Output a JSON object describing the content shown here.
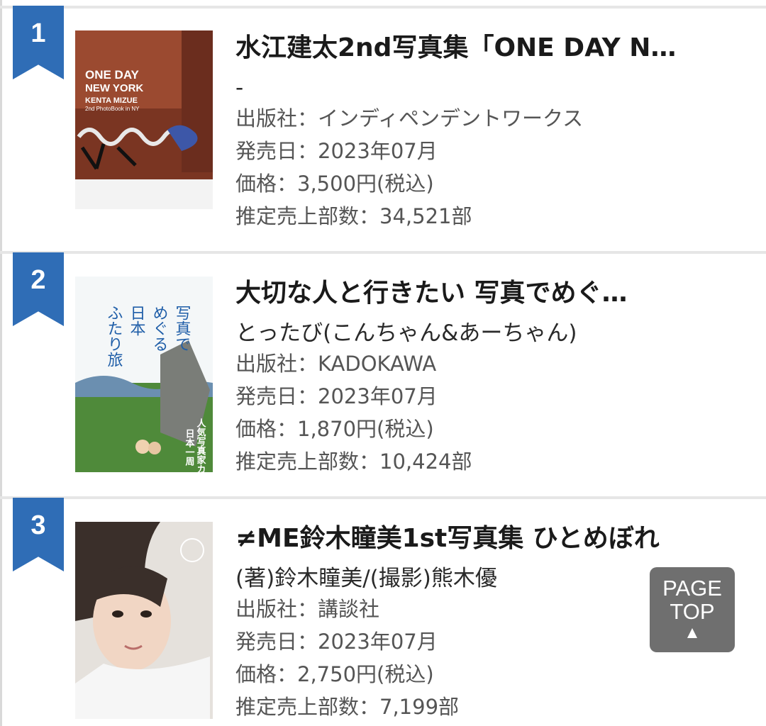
{
  "labels": {
    "publisher": "出版社：",
    "release": "発売日：",
    "price": "価格：",
    "estimate": "推定売上部数："
  },
  "items": [
    {
      "rank": "1",
      "title": "水江建太2nd写真集「ONE DAY N…",
      "author": "-",
      "publisher": "インディペンデントワークス",
      "release": "2023年07月",
      "price": "3,500円(税込)",
      "estimate": "34,521部",
      "cover_text": [
        "ONE DAY",
        "NEW YORK",
        "KENTA MIZUE",
        "2nd PhotoBook in NY"
      ]
    },
    {
      "rank": "2",
      "title": "大切な人と行きたい 写真でめぐ…",
      "author": "とったび(こんちゃん&あーちゃん)",
      "publisher": "KADOKAWA",
      "release": "2023年07月",
      "price": "1,870円(税込)",
      "estimate": "10,424部",
      "cover_text": [
        "写真で",
        "めぐる",
        "日本",
        "ふたり旅",
        "人気写真家カップル",
        "日本一周"
      ]
    },
    {
      "rank": "3",
      "title": "≠ME鈴木瞳美1st写真集 ひとめぼれ",
      "author": "(著)鈴木瞳美/(撮影)熊木優",
      "publisher": "講談社",
      "release": "2023年07月",
      "price": "2,750円(税込)",
      "estimate": "7,199部",
      "cover_text": []
    }
  ],
  "page_top": {
    "line1": "PAGE",
    "line2": "TOP",
    "arrow": "▲"
  },
  "colors": {
    "ribbon": "#2f6db6",
    "page_top_bg": "#6f6f6f"
  }
}
